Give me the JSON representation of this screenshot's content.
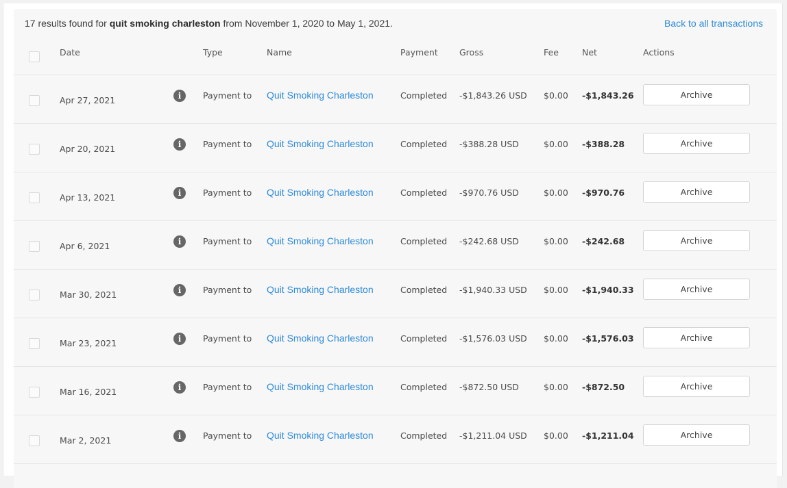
{
  "summary": {
    "prefix": "17 results found for ",
    "query": "quit smoking charleston",
    "suffix": " from November 1, 2020 to May 1, 2021.",
    "back_link": "Back to all transactions"
  },
  "columns": {
    "date": "Date",
    "type": "Type",
    "name": "Name",
    "payment": "Payment",
    "gross": "Gross",
    "fee": "Fee",
    "net": "Net",
    "actions": "Actions"
  },
  "info_icon_glyph": "i",
  "rows": [
    {
      "date": "Apr 27, 2021",
      "type": "Payment to",
      "name": "Quit Smoking Charleston",
      "payment": "Completed",
      "gross": "-$1,843.26 USD",
      "fee": "$0.00",
      "net": "-$1,843.26",
      "action": "Archive"
    },
    {
      "date": "Apr 20, 2021",
      "type": "Payment to",
      "name": "Quit Smoking Charleston",
      "payment": "Completed",
      "gross": "-$388.28 USD",
      "fee": "$0.00",
      "net": "-$388.28",
      "action": "Archive"
    },
    {
      "date": "Apr 13, 2021",
      "type": "Payment to",
      "name": "Quit Smoking Charleston",
      "payment": "Completed",
      "gross": "-$970.76 USD",
      "fee": "$0.00",
      "net": "-$970.76",
      "action": "Archive"
    },
    {
      "date": "Apr 6, 2021",
      "type": "Payment to",
      "name": "Quit Smoking Charleston",
      "payment": "Completed",
      "gross": "-$242.68 USD",
      "fee": "$0.00",
      "net": "-$242.68",
      "action": "Archive"
    },
    {
      "date": "Mar 30, 2021",
      "type": "Payment to",
      "name": "Quit Smoking Charleston",
      "payment": "Completed",
      "gross": "-$1,940.33 USD",
      "fee": "$0.00",
      "net": "-$1,940.33",
      "action": "Archive"
    },
    {
      "date": "Mar 23, 2021",
      "type": "Payment to",
      "name": "Quit Smoking Charleston",
      "payment": "Completed",
      "gross": "-$1,576.03 USD",
      "fee": "$0.00",
      "net": "-$1,576.03",
      "action": "Archive"
    },
    {
      "date": "Mar 16, 2021",
      "type": "Payment to",
      "name": "Quit Smoking Charleston",
      "payment": "Completed",
      "gross": "-$872.50 USD",
      "fee": "$0.00",
      "net": "-$872.50",
      "action": "Archive"
    },
    {
      "date": "Mar 2, 2021",
      "type": "Payment to",
      "name": "Quit Smoking Charleston",
      "payment": "Completed",
      "gross": "-$1,211.04 USD",
      "fee": "$0.00",
      "net": "-$1,211.04",
      "action": "Archive"
    }
  ],
  "colors": {
    "link": "#2d8ad8",
    "panel_bg": "#f7f7f8",
    "info_icon": "#666666"
  }
}
